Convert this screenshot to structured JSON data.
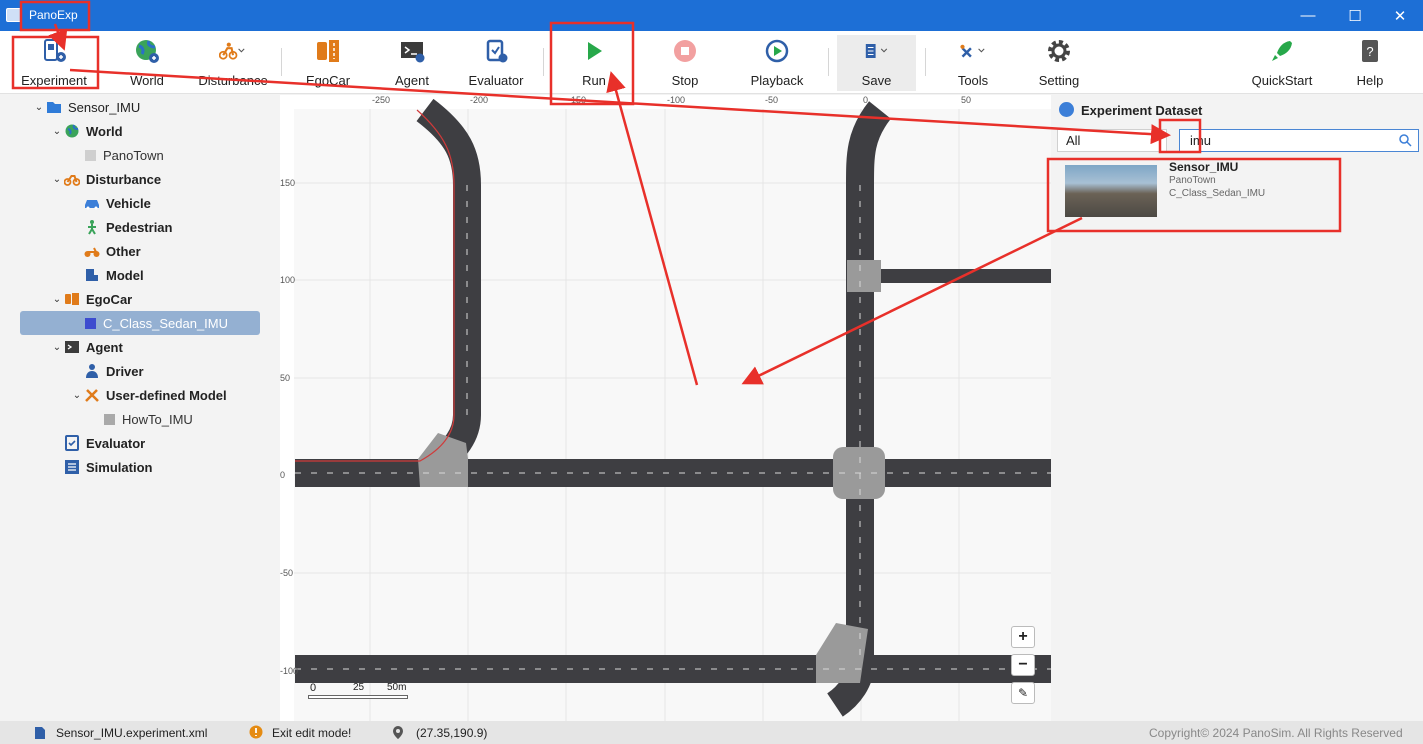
{
  "window": {
    "title": "PanoExp"
  },
  "toolbar": {
    "experiment": "Experiment",
    "world": "World",
    "disturbance": "Disturbance",
    "egocar": "EgoCar",
    "agent": "Agent",
    "evaluator": "Evaluator",
    "run": "Run",
    "stop": "Stop",
    "playback": "Playback",
    "save": "Save",
    "tools": "Tools",
    "setting": "Setting",
    "quickstart": "QuickStart",
    "help": "Help"
  },
  "tree": {
    "root": "Sensor_IMU",
    "world": "World",
    "panotown": "PanoTown",
    "disturbance": "Disturbance",
    "vehicle": "Vehicle",
    "pedestrian": "Pedestrian",
    "other": "Other",
    "model": "Model",
    "egocar": "EgoCar",
    "egocar_item": "C_Class_Sedan_IMU",
    "agent": "Agent",
    "driver": "Driver",
    "user_model": "User-defined Model",
    "howto": "HowTo_IMU",
    "evaluator": "Evaluator",
    "simulation": "Simulation"
  },
  "map": {
    "x_ticks": [
      "-250",
      "-200",
      "-150",
      "-100",
      "-50",
      "0",
      "50"
    ],
    "y_ticks": [
      "150",
      "100",
      "50",
      "0",
      "-50",
      "-100"
    ],
    "scale_labels": [
      "0",
      "25",
      "50m"
    ],
    "zoom_in": "+",
    "zoom_out": "−"
  },
  "dataset": {
    "title": "Experiment Dataset",
    "filter": "All",
    "search_value": "imu",
    "item": {
      "name": "Sensor_IMU",
      "map": "PanoTown",
      "car": "C_Class_Sedan_IMU"
    }
  },
  "status": {
    "file": "Sensor_IMU.experiment.xml",
    "mode": "Exit edit mode!",
    "coords": "(27.35,190.9)",
    "copyright": "Copyright© 2024 PanoSim. All Rights Reserved"
  },
  "colors": {
    "titlebar": "#1d6fd6",
    "annotation": "#e8302a",
    "road": "#3e3e42",
    "selection": "#94b0d2"
  }
}
